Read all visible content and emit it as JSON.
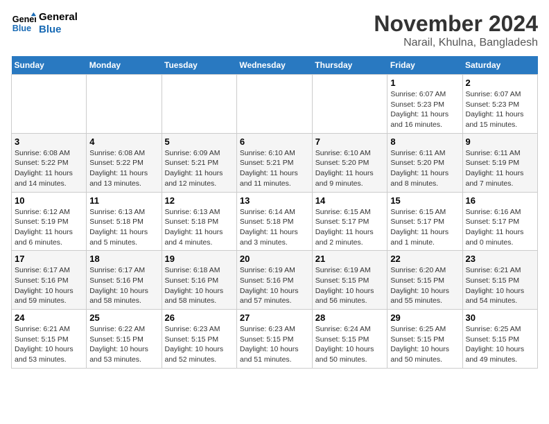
{
  "logo": {
    "line1": "General",
    "line2": "Blue"
  },
  "title": "November 2024",
  "subtitle": "Narail, Khulna, Bangladesh",
  "days_of_week": [
    "Sunday",
    "Monday",
    "Tuesday",
    "Wednesday",
    "Thursday",
    "Friday",
    "Saturday"
  ],
  "weeks": [
    [
      {
        "day": "",
        "detail": ""
      },
      {
        "day": "",
        "detail": ""
      },
      {
        "day": "",
        "detail": ""
      },
      {
        "day": "",
        "detail": ""
      },
      {
        "day": "",
        "detail": ""
      },
      {
        "day": "1",
        "detail": "Sunrise: 6:07 AM\nSunset: 5:23 PM\nDaylight: 11 hours and 16 minutes."
      },
      {
        "day": "2",
        "detail": "Sunrise: 6:07 AM\nSunset: 5:23 PM\nDaylight: 11 hours and 15 minutes."
      }
    ],
    [
      {
        "day": "3",
        "detail": "Sunrise: 6:08 AM\nSunset: 5:22 PM\nDaylight: 11 hours and 14 minutes."
      },
      {
        "day": "4",
        "detail": "Sunrise: 6:08 AM\nSunset: 5:22 PM\nDaylight: 11 hours and 13 minutes."
      },
      {
        "day": "5",
        "detail": "Sunrise: 6:09 AM\nSunset: 5:21 PM\nDaylight: 11 hours and 12 minutes."
      },
      {
        "day": "6",
        "detail": "Sunrise: 6:10 AM\nSunset: 5:21 PM\nDaylight: 11 hours and 11 minutes."
      },
      {
        "day": "7",
        "detail": "Sunrise: 6:10 AM\nSunset: 5:20 PM\nDaylight: 11 hours and 9 minutes."
      },
      {
        "day": "8",
        "detail": "Sunrise: 6:11 AM\nSunset: 5:20 PM\nDaylight: 11 hours and 8 minutes."
      },
      {
        "day": "9",
        "detail": "Sunrise: 6:11 AM\nSunset: 5:19 PM\nDaylight: 11 hours and 7 minutes."
      }
    ],
    [
      {
        "day": "10",
        "detail": "Sunrise: 6:12 AM\nSunset: 5:19 PM\nDaylight: 11 hours and 6 minutes."
      },
      {
        "day": "11",
        "detail": "Sunrise: 6:13 AM\nSunset: 5:18 PM\nDaylight: 11 hours and 5 minutes."
      },
      {
        "day": "12",
        "detail": "Sunrise: 6:13 AM\nSunset: 5:18 PM\nDaylight: 11 hours and 4 minutes."
      },
      {
        "day": "13",
        "detail": "Sunrise: 6:14 AM\nSunset: 5:18 PM\nDaylight: 11 hours and 3 minutes."
      },
      {
        "day": "14",
        "detail": "Sunrise: 6:15 AM\nSunset: 5:17 PM\nDaylight: 11 hours and 2 minutes."
      },
      {
        "day": "15",
        "detail": "Sunrise: 6:15 AM\nSunset: 5:17 PM\nDaylight: 11 hours and 1 minute."
      },
      {
        "day": "16",
        "detail": "Sunrise: 6:16 AM\nSunset: 5:17 PM\nDaylight: 11 hours and 0 minutes."
      }
    ],
    [
      {
        "day": "17",
        "detail": "Sunrise: 6:17 AM\nSunset: 5:16 PM\nDaylight: 10 hours and 59 minutes."
      },
      {
        "day": "18",
        "detail": "Sunrise: 6:17 AM\nSunset: 5:16 PM\nDaylight: 10 hours and 58 minutes."
      },
      {
        "day": "19",
        "detail": "Sunrise: 6:18 AM\nSunset: 5:16 PM\nDaylight: 10 hours and 58 minutes."
      },
      {
        "day": "20",
        "detail": "Sunrise: 6:19 AM\nSunset: 5:16 PM\nDaylight: 10 hours and 57 minutes."
      },
      {
        "day": "21",
        "detail": "Sunrise: 6:19 AM\nSunset: 5:15 PM\nDaylight: 10 hours and 56 minutes."
      },
      {
        "day": "22",
        "detail": "Sunrise: 6:20 AM\nSunset: 5:15 PM\nDaylight: 10 hours and 55 minutes."
      },
      {
        "day": "23",
        "detail": "Sunrise: 6:21 AM\nSunset: 5:15 PM\nDaylight: 10 hours and 54 minutes."
      }
    ],
    [
      {
        "day": "24",
        "detail": "Sunrise: 6:21 AM\nSunset: 5:15 PM\nDaylight: 10 hours and 53 minutes."
      },
      {
        "day": "25",
        "detail": "Sunrise: 6:22 AM\nSunset: 5:15 PM\nDaylight: 10 hours and 53 minutes."
      },
      {
        "day": "26",
        "detail": "Sunrise: 6:23 AM\nSunset: 5:15 PM\nDaylight: 10 hours and 52 minutes."
      },
      {
        "day": "27",
        "detail": "Sunrise: 6:23 AM\nSunset: 5:15 PM\nDaylight: 10 hours and 51 minutes."
      },
      {
        "day": "28",
        "detail": "Sunrise: 6:24 AM\nSunset: 5:15 PM\nDaylight: 10 hours and 50 minutes."
      },
      {
        "day": "29",
        "detail": "Sunrise: 6:25 AM\nSunset: 5:15 PM\nDaylight: 10 hours and 50 minutes."
      },
      {
        "day": "30",
        "detail": "Sunrise: 6:25 AM\nSunset: 5:15 PM\nDaylight: 10 hours and 49 minutes."
      }
    ]
  ]
}
